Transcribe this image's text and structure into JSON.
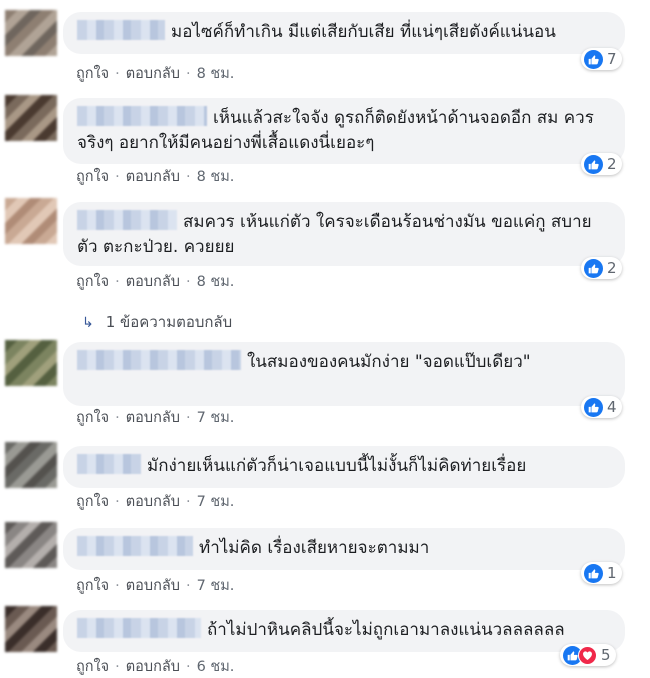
{
  "comments": [
    {
      "text": "มอไซค์ก็ทำเกิน มีแต่เสียกับเสีย ที่แน่ๆเสียตังค์แน่นอน",
      "like": "ถูกใจ",
      "reply": "ตอบกลับ",
      "time": "8 ชม.",
      "reactions": "7"
    },
    {
      "text": "เห็นแล้วสะใจจัง ดูรถก็ติดยังหน้าด้านจอดอีก สม ควรจริงๆ อยากให้มีคนอย่างพี่เสื้อแดงนี่เยอะๆ",
      "like": "ถูกใจ",
      "reply": "ตอบกลับ",
      "time": "8 ชม.",
      "reactions": "2"
    },
    {
      "text": "สมควร เห้นแก่ตัว ใครจะเดือนร้อนช่างมัน ขอแค่กู สบายตัว ตะกะป่วย. ควยยย",
      "like": "ถูกใจ",
      "reply": "ตอบกลับ",
      "time": "8 ชม.",
      "reactions": "2"
    },
    {
      "text": "ในสมองของคนมักง่าย \"จอดแป๊บเดียว\"",
      "like": "ถูกใจ",
      "reply": "ตอบกลับ",
      "time": "7 ชม.",
      "reactions": "4"
    },
    {
      "text": "มักง่ายเห็นแก่ตัวก็น่าเจอแบบนี้ไม่งั้นก็ไม่คิดท่ายเรื่อย",
      "like": "ถูกใจ",
      "reply": "ตอบกลับ",
      "time": "7 ชม.",
      "reactions": ""
    },
    {
      "text": "ทำไม่คิด เรื่องเสียหายจะตามมา",
      "like": "ถูกใจ",
      "reply": "ตอบกลับ",
      "time": "7 ชม.",
      "reactions": "1"
    },
    {
      "text": "ถ้าไม่ปาหินคลิปนี้จะไม่ถูกเอามาลงแน่นวลลลลลล",
      "like": "ถูกใจ",
      "reply": "ตอบกลับ",
      "time": "6 ชม.",
      "reactions": "5"
    }
  ],
  "replies_link": "1 ข้อความตอบกลับ",
  "icons": {
    "like": "like-icon",
    "love": "love-icon",
    "reply_arrow": "reply-arrow-icon"
  },
  "colors": {
    "like_blue": "#1877f2",
    "love_red": "#f0284a",
    "bubble_bg": "#f2f3f5",
    "meta_text": "#606770"
  }
}
